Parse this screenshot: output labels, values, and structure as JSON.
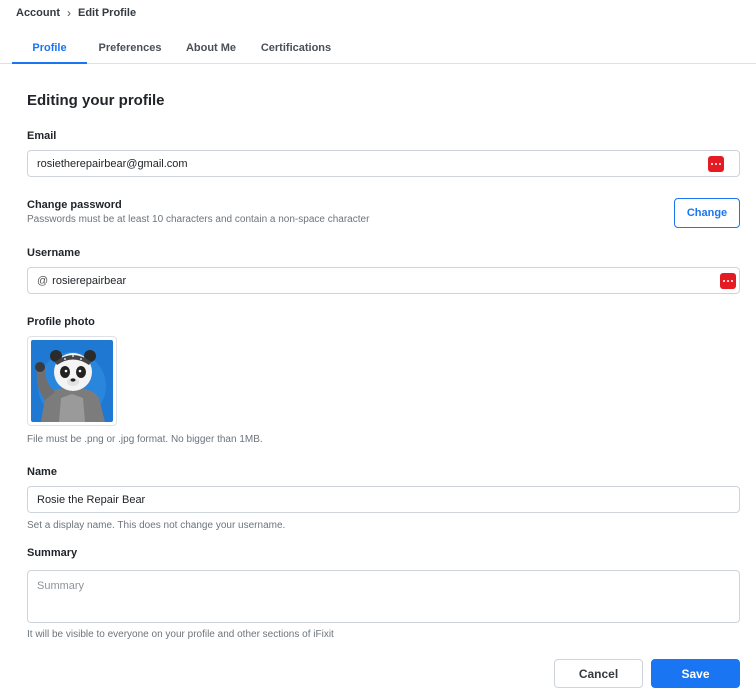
{
  "breadcrumb": {
    "parent": "Account",
    "current": "Edit Profile"
  },
  "tabs": [
    {
      "label": "Profile",
      "active": true
    },
    {
      "label": "Preferences",
      "active": false
    },
    {
      "label": "About Me",
      "active": false
    },
    {
      "label": "Certifications",
      "active": false
    }
  ],
  "page_title": "Editing your profile",
  "email": {
    "label": "Email",
    "value": "rosietherepairbear@gmail.com"
  },
  "password": {
    "label": "Change password",
    "help": "Passwords must be at least 10 characters and contain a non-space character",
    "button": "Change"
  },
  "username": {
    "label": "Username",
    "prefix": "@",
    "value": "rosierepairbear"
  },
  "photo": {
    "label": "Profile photo",
    "help": "File must be .png or .jpg format. No bigger than 1MB."
  },
  "name": {
    "label": "Name",
    "value": "Rosie the Repair Bear",
    "help": "Set a display name. This does not change your username."
  },
  "summary": {
    "label": "Summary",
    "placeholder": "Summary",
    "help": "It will be visible to everyone on your profile and other sections of iFixit"
  },
  "actions": {
    "cancel": "Cancel",
    "save": "Save"
  },
  "colors": {
    "accent": "#1975f1",
    "password_manager_icon": "#e51b24",
    "photo_background": "#1f78d1"
  }
}
